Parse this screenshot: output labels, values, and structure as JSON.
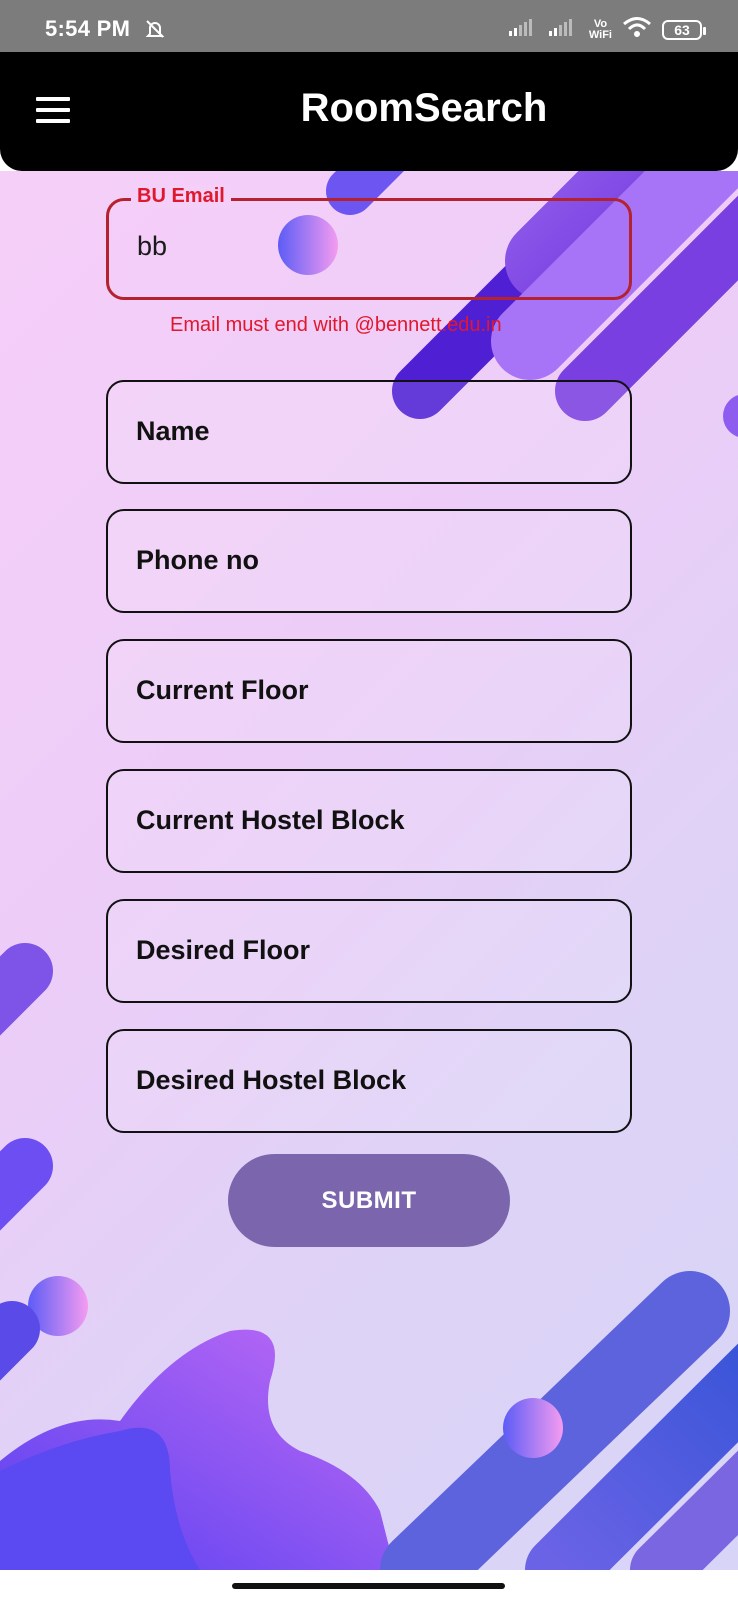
{
  "status_bar": {
    "time": "5:54 PM",
    "vo_wifi_top": "Vo",
    "vo_wifi_bottom": "WiFi",
    "battery": "63"
  },
  "app_bar": {
    "title": "RoomSearch"
  },
  "form": {
    "email": {
      "label": "BU Email",
      "value": "bb",
      "error": "Email must end with @bennett.edu.in"
    },
    "fields": [
      {
        "label": "Name"
      },
      {
        "label": "Phone no"
      },
      {
        "label": "Current Floor"
      },
      {
        "label": "Current Hostel Block"
      },
      {
        "label": "Desired Floor"
      },
      {
        "label": "Desired Hostel Block"
      }
    ],
    "submit_label": "SUBMIT"
  },
  "colors": {
    "app_bar": "#000000",
    "error": "#e0182e",
    "submit_button": "#7b66ad",
    "background_start": "#f6cff8",
    "background_end": "#d8d4f8"
  }
}
